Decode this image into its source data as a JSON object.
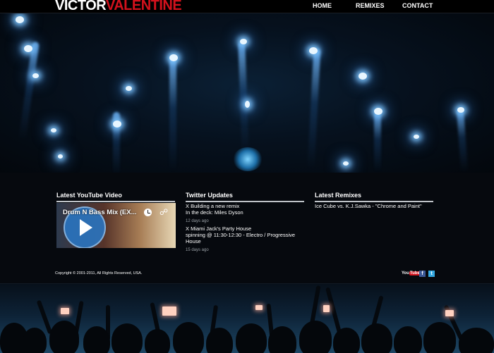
{
  "brand": {
    "first": "VICTOR",
    "last": "VALENTINE"
  },
  "nav": {
    "home": "HOME",
    "remixes": "REMIXES",
    "contact": "CONTACT"
  },
  "sections": {
    "youtube_title": "Latest YouTube Video",
    "twitter_title": "Twitter Updates",
    "remixes_title": "Latest Remixes"
  },
  "video": {
    "title": "Drum N Bass Mix (EX..."
  },
  "tweets": [
    {
      "line1": "X Building a new remix",
      "line2": "In the deck: Miles Dyson",
      "ago": "12 days ago"
    },
    {
      "line1": "X Miami Jack's Party House",
      "line2": "spinning @ 11:30-12:30 - Electro / Progressive House",
      "ago": "15 days ago"
    }
  ],
  "remixes": [
    "Ice Cube vs. K.J.Sawka - \"Chrome and Paint\""
  ],
  "footer": {
    "copyright": "Copyright © 2001-2011, All Rights Reserved, USA.",
    "youtube_you": "You",
    "youtube_tube": "Tube",
    "facebook": "f",
    "twitter": "t"
  },
  "colors": {
    "accent_red": "#d3111c",
    "background": "#05080d",
    "beam_blue": "#78beff"
  },
  "icons": [
    "play-icon",
    "clock-icon",
    "share-icon",
    "youtube-icon",
    "facebook-icon",
    "twitter-icon"
  ]
}
